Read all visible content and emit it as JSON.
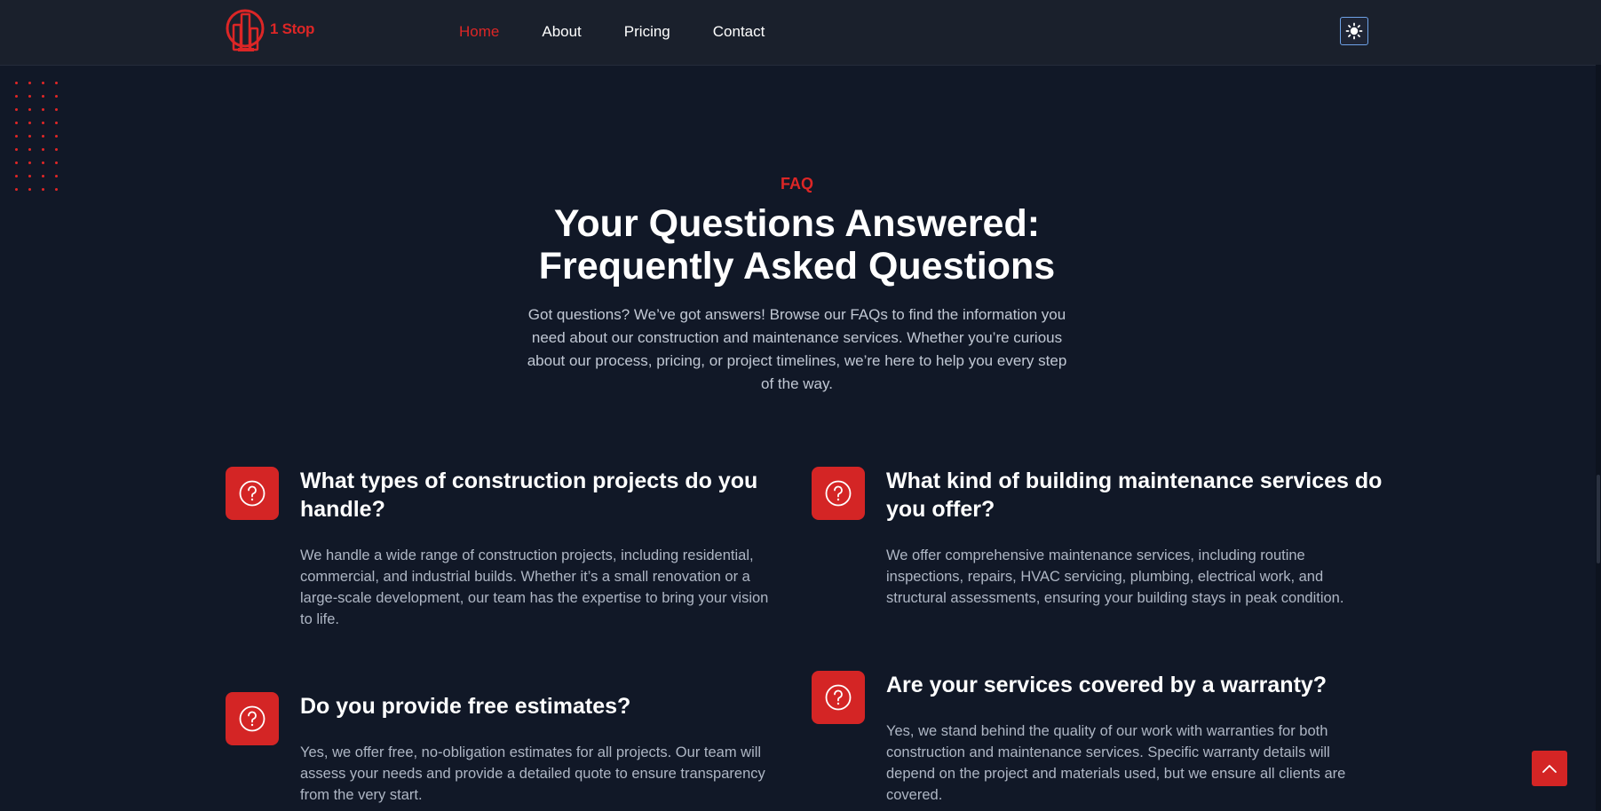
{
  "brand": {
    "name": "1 Stop",
    "accent_color": "#dc2626"
  },
  "nav": {
    "items": [
      {
        "label": "Home",
        "active": true
      },
      {
        "label": "About",
        "active": false
      },
      {
        "label": "Pricing",
        "active": false
      },
      {
        "label": "Contact",
        "active": false
      }
    ],
    "theme_toggle_icon": "sun-icon"
  },
  "faq": {
    "label": "FAQ",
    "title_line1": "Your Questions Answered:",
    "title_line2": "Frequently Asked Questions",
    "intro": "Got questions? We’ve got answers! Browse our FAQs to find the information you need about our construction and maintenance services. Whether you’re curious about our process, pricing, or project timelines, we’re here to help you every step of the way.",
    "items": [
      {
        "icon": "question-circle-icon",
        "question": "What types of construction projects do you handle?",
        "answer": "We handle a wide range of construction projects, including residential, commercial, and industrial builds. Whether it’s a small renovation or a large-scale development, our team has the expertise to bring your vision to life."
      },
      {
        "icon": "question-circle-icon",
        "question": "What kind of building maintenance services do you offer?",
        "answer": "We offer comprehensive maintenance services, including routine inspections, repairs, HVAC servicing, plumbing, electrical work, and structural assessments, ensuring your building stays in peak condition."
      },
      {
        "icon": "question-circle-icon",
        "question": "Do you provide free estimates?",
        "answer": "Yes, we offer free, no-obligation estimates for all projects. Our team will assess your needs and provide a detailed quote to ensure transparency from the very start."
      },
      {
        "icon": "question-circle-icon",
        "question": "Are your services covered by a warranty?",
        "answer": "Yes, we stand behind the quality of our work with warranties for both construction and maintenance services. Specific warranty details will depend on the project and materials used, but we ensure all clients are covered."
      }
    ]
  },
  "back_to_top_icon": "chevron-up-icon"
}
